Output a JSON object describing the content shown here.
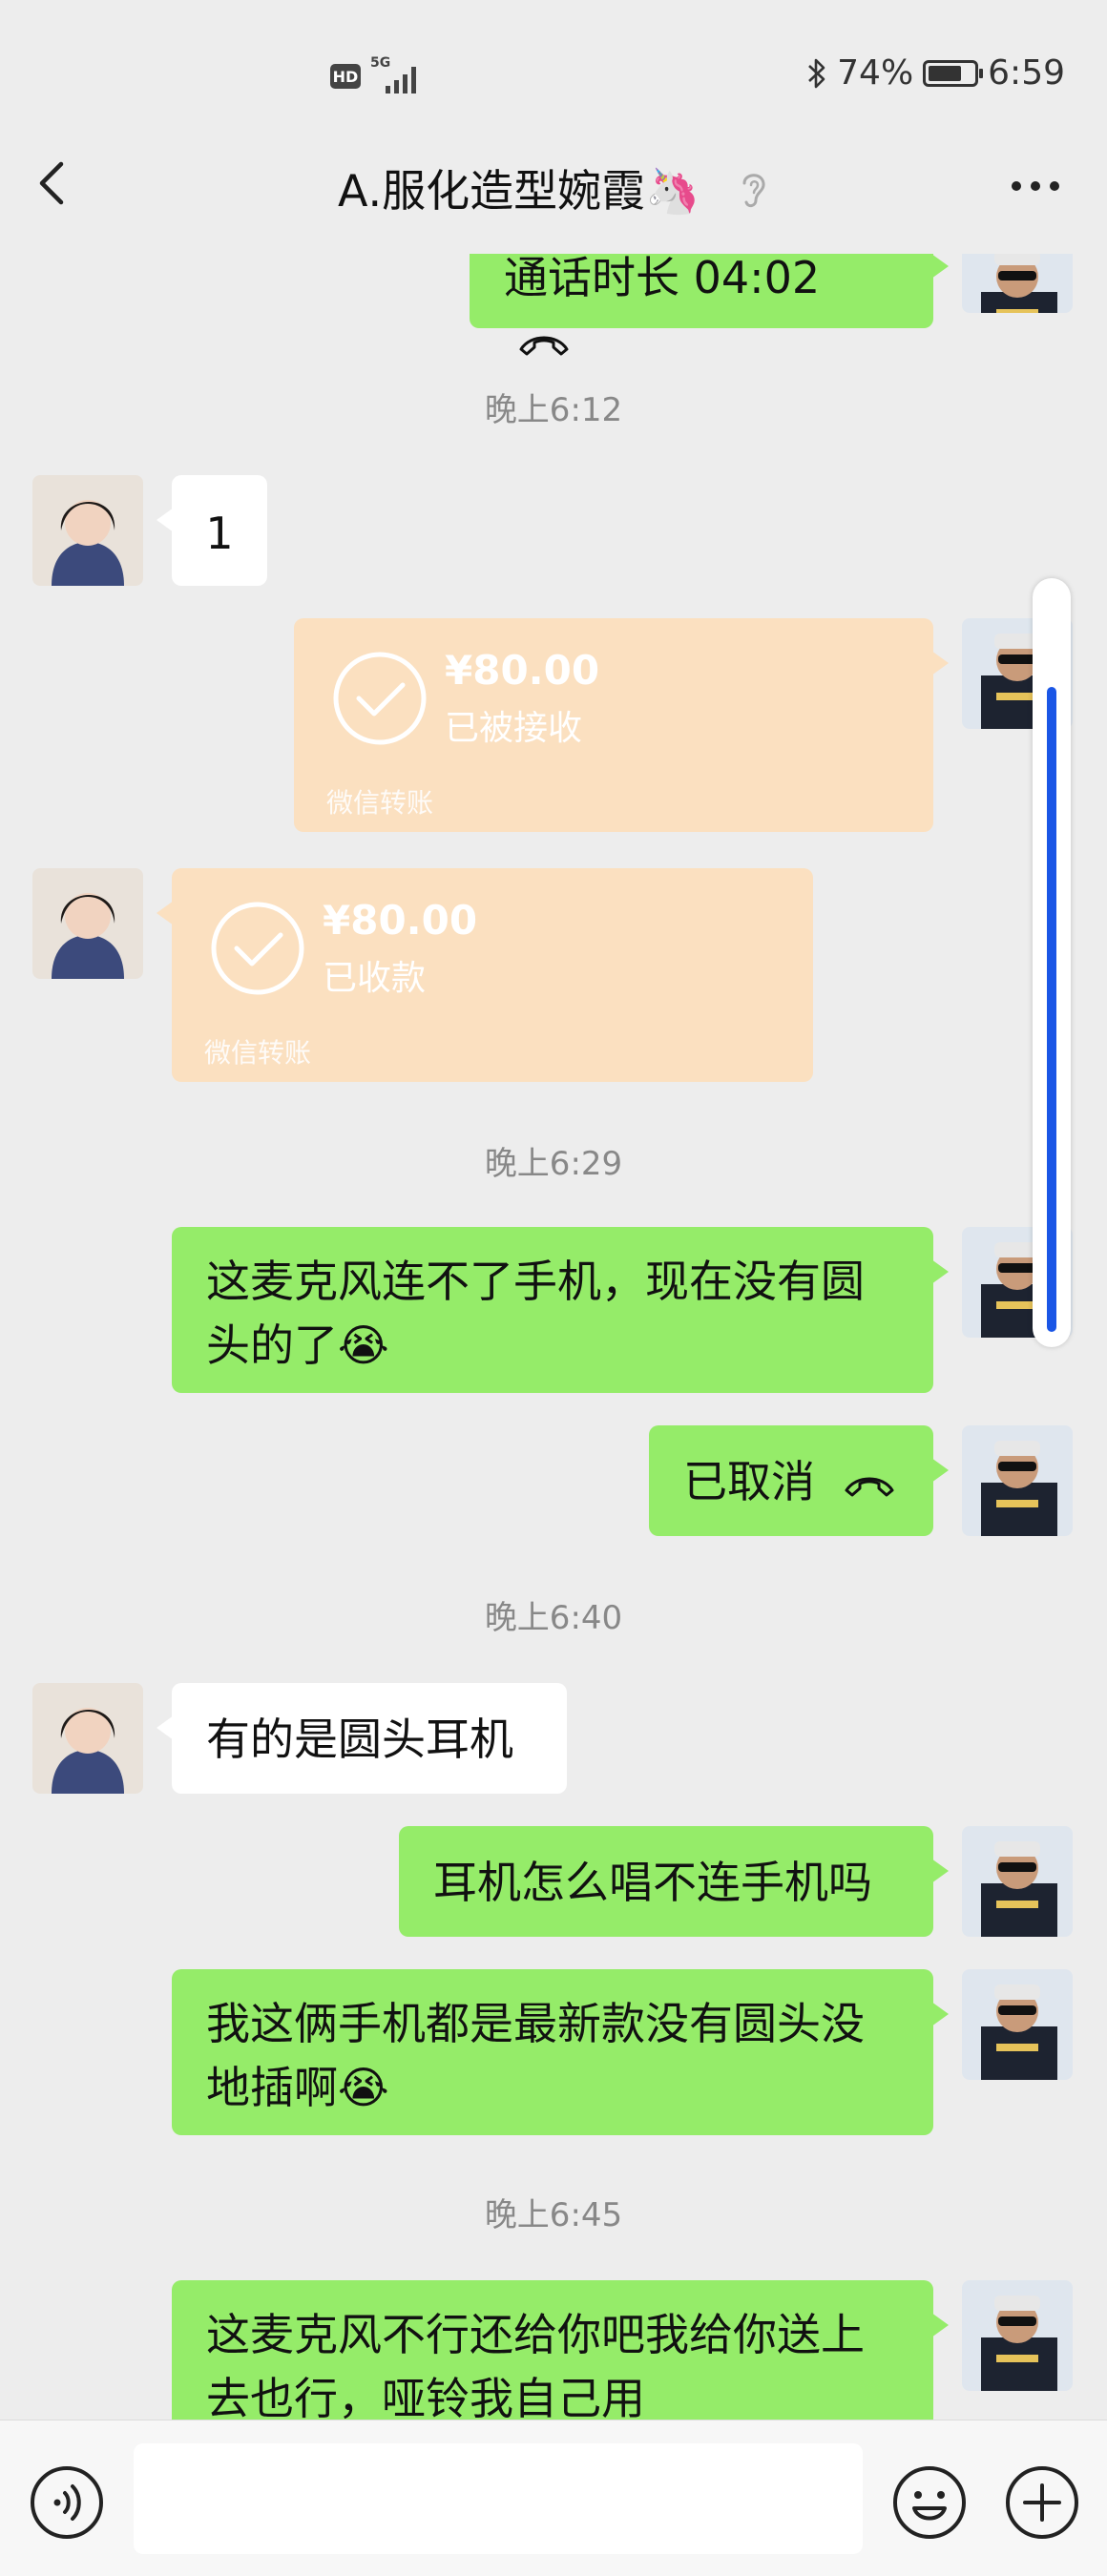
{
  "status_bar": {
    "hd": "HD",
    "network": "5G",
    "battery_pct": "74%",
    "battery_level": 0.74,
    "time": "6:59"
  },
  "header": {
    "title": "ꓮ.服化造型婉霞🦄"
  },
  "messages": {
    "call_duration": "通话时长 04:02",
    "time1": "晚上6:12",
    "msg_one": "1",
    "transfer1": {
      "amount": "¥80.00",
      "status": "已被接收",
      "footer": "微信转账"
    },
    "transfer2": {
      "amount": "¥80.00",
      "status": "已收款",
      "footer": "微信转账"
    },
    "time2": "晚上6:29",
    "msg_mic": "这麦克风连不了手机，现在没有圆头的了😭",
    "msg_cancel": "已取消",
    "time3": "晚上6:40",
    "msg_round": "有的是圆头耳机",
    "msg_sing": "耳机怎么唱不连手机吗",
    "msg_phones": "我这俩手机都是最新款没有圆头没地插啊😭",
    "time4": "晚上6:45",
    "msg_return": "这麦克风不行还给你吧我给你送上去也行，哑铃我自己用"
  },
  "input": {
    "placeholder": ""
  },
  "colors": {
    "my_bubble": "#95ec69",
    "their_bubble": "#ffffff",
    "transfer": "#fbe0c0",
    "background": "#ededed",
    "scroll_thumb": "#1a56e6"
  },
  "icons": [
    "back-arrow-icon",
    "ear-icon",
    "more-icon",
    "hangup-phone-icon",
    "check-circle-icon",
    "voice-icon",
    "emoji-icon",
    "plus-circle-icon"
  ]
}
